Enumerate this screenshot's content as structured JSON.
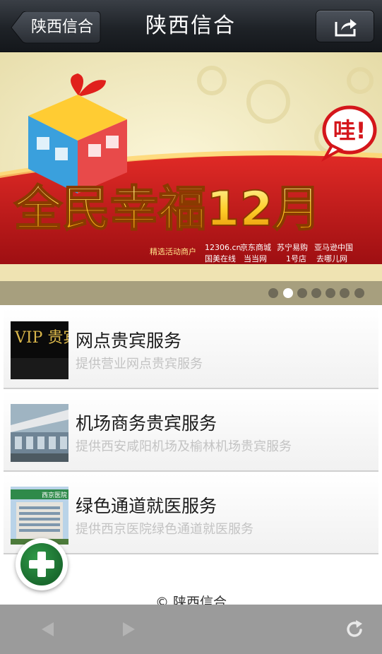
{
  "header": {
    "back_label": "陕西信合",
    "title": "陕西信合",
    "share_icon": "share-icon"
  },
  "banner": {
    "headline": "全民幸福12月",
    "exclaim": "哇!",
    "tagline": "精选活动商户",
    "merchants": [
      "12306.cn",
      "京东商城",
      "苏宁易购",
      "亚马逊中国",
      "国美在线",
      "当当网",
      "1号店",
      "去哪儿网"
    ],
    "page_count": 7,
    "active_page": 2
  },
  "list": {
    "items": [
      {
        "title": "网点贵宾服务",
        "subtitle": "提供营业网点贵宾服务",
        "thumb_text": "VIP 贵宾卡"
      },
      {
        "title": "机场商务贵宾服务",
        "subtitle": "提供西安咸阳机场及榆林机场贵宾服务",
        "thumb_text": ""
      },
      {
        "title": "绿色通道就医服务",
        "subtitle": "提供西京医院绿色通道就医服务",
        "thumb_text": "西京医院"
      }
    ]
  },
  "footer": {
    "copyright": "© 陕西信合"
  },
  "fab": {
    "icon": "plus-icon"
  },
  "toolbar": {
    "back_icon": "back-arrow-icon",
    "forward_icon": "forward-arrow-icon",
    "refresh_icon": "refresh-icon"
  },
  "colors": {
    "header": "#1e2227",
    "banner_red": "#c8181f",
    "fab_green": "#1f7a35",
    "toolbar": "#9b9b9b"
  }
}
